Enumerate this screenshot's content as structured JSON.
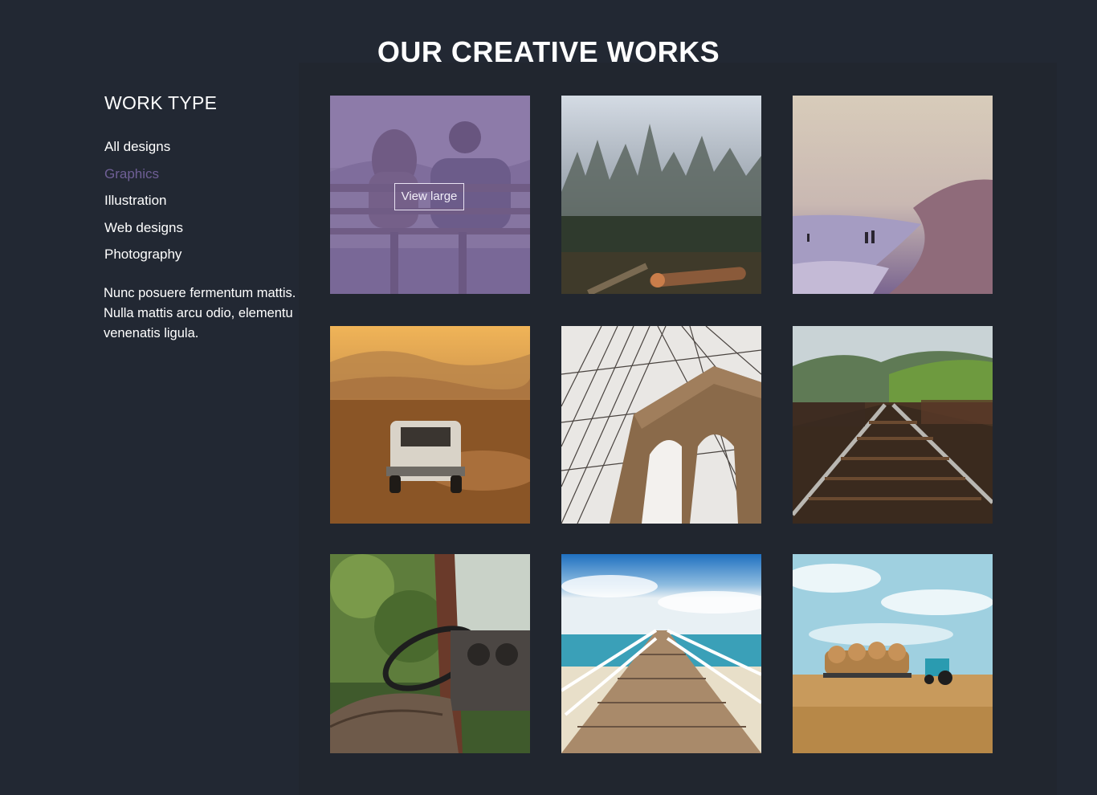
{
  "section": {
    "title": "OUR CREATIVE WORKS"
  },
  "sidebar": {
    "heading": "WORK TYPE",
    "filters": [
      {
        "label": "All designs",
        "active": false
      },
      {
        "label": "Graphics",
        "active": true
      },
      {
        "label": "Illustration",
        "active": false
      },
      {
        "label": "Web designs",
        "active": false
      },
      {
        "label": "Photography",
        "active": false
      }
    ],
    "description": "Nunc posuere fermentum mattis. Nulla mattis arcu odio, elementu venenatis ligula."
  },
  "gallery": {
    "hover_button_label": "View large",
    "items": [
      {
        "subject": "couple-on-bench",
        "hovered": true
      },
      {
        "subject": "misty-forest"
      },
      {
        "subject": "beach-sunset"
      },
      {
        "subject": "van-in-desert"
      },
      {
        "subject": "suspension-bridge"
      },
      {
        "subject": "railway-tracks"
      },
      {
        "subject": "old-car-interior"
      },
      {
        "subject": "pier-to-sea"
      },
      {
        "subject": "tractor-hay-field"
      }
    ]
  },
  "colors": {
    "background": "#222833",
    "accent": "#6f5f96",
    "overlay": "#7862a0",
    "text": "#ffffff"
  }
}
